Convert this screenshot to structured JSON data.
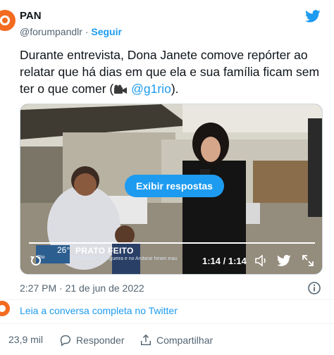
{
  "author": {
    "name": "PAN",
    "handle": "@forumpandlr",
    "separator": "·",
    "follow_label": "Seguir",
    "avatar_icon": "pan-logo-icon",
    "brand_color": "#f26b21"
  },
  "tweet": {
    "text_main": "Durante entrevista, Dona Janete comove repórter ao relatar que há dias em que ela e sua família ficam sem ter o que comer (",
    "text_icon": "movie-camera-icon",
    "mention": "@g1rio",
    "text_end": ").",
    "timestamp": "2:27 PM · 21 de jun de 2022"
  },
  "video": {
    "show_replies_label": "Exibir respostas",
    "time": "1:14 / 1:14",
    "progress": 1.0,
    "lower_third": {
      "temperature": "26°",
      "city": "Rio",
      "program": "PRATO FEITO",
      "ticker": "Cozinhas na Mangueira e no Andaraí foram inau"
    }
  },
  "conversation_link": "Leia a conversa completa no Twitter",
  "actions": {
    "likes": "23,9 mil",
    "reply_label": "Responder",
    "share_label": "Compartilhar"
  },
  "colors": {
    "accent": "#1d9bf0",
    "text": "#0f1419",
    "muted": "#536471"
  }
}
